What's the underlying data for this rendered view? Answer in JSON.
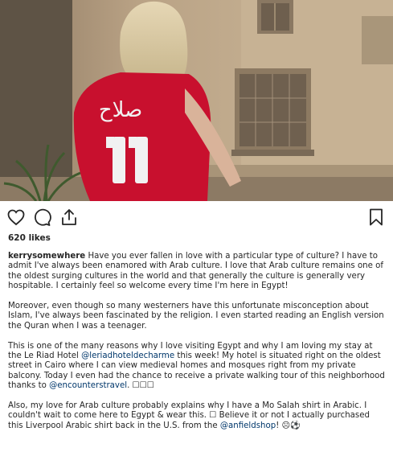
{
  "post": {
    "jersey_name": "صلاح",
    "jersey_number": "11",
    "likes_text": "620 likes",
    "username": "kerrysomewhere",
    "caption": {
      "p1": "Have you ever fallen in love with a particular type of culture? I have to admit I've always been enamored with Arab culture. I love that Arab culture remains one of the oldest surging cultures in the world and that generally the culture is generally very hospitable. I certainly feel so welcome every time I'm here in Egypt!",
      "p2": "Moreover, even though so many westerners have this unfortunate misconception about Islam, I've always been fascinated by the religion. I even started reading an English version the Quran when I was a teenager.",
      "p3_a": "This is one of the many reasons why I love visiting Egypt and why I am loving my stay at the Le Riad Hotel",
      "p3_mention1": "@leriadhoteldecharme",
      "p3_b": "this week! My hotel is situated right on the oldest street in Cairo where I can view medieval homes and mosques right from my private balcony. Today I even had the chance to receive a private walking tour of this neighborhood thanks to",
      "p3_mention2": "@encounterstravel",
      "p3_c": ". ☐☐☐",
      "p4_a": "Also, my love for Arab culture probably explains why I have a Mo Salah shirt in Arabic. I couldn't wait to come here to Egypt & wear this. ☐ Believe it or not I actually purchased this Liverpool Arabic shirt back in the U.S. from the",
      "p4_mention": "@anfieldshop",
      "p4_b": "! ☹⚽"
    }
  },
  "icons": {
    "like": "heart-outline-icon",
    "comment": "comment-bubble-icon",
    "share": "share-upload-icon",
    "save": "bookmark-icon"
  },
  "colors": {
    "text": "#262626",
    "mention": "#00376b",
    "jersey": "#c8102e"
  }
}
